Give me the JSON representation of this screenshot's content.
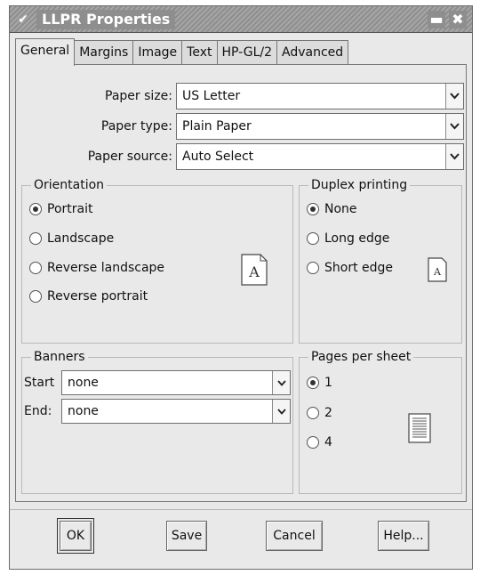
{
  "window": {
    "title": "LLPR Properties",
    "menu_glyph": "✔",
    "minimize_glyph": "▬",
    "close_glyph": "✖"
  },
  "tabs": [
    {
      "label": "General",
      "active": true
    },
    {
      "label": "Margins"
    },
    {
      "label": "Image"
    },
    {
      "label": "Text"
    },
    {
      "label": "HP-GL/2"
    },
    {
      "label": "Advanced"
    }
  ],
  "paper": {
    "size_label": "Paper size:",
    "size_value": "US Letter",
    "type_label": "Paper type:",
    "type_value": "Plain Paper",
    "source_label": "Paper source:",
    "source_value": "Auto Select"
  },
  "orientation": {
    "title": "Orientation",
    "options": [
      "Portrait",
      "Landscape",
      "Reverse landscape",
      "Reverse portrait"
    ],
    "selected": 0,
    "preview_letter": "A"
  },
  "duplex": {
    "title": "Duplex printing",
    "options": [
      "None",
      "Long edge",
      "Short edge"
    ],
    "selected": 0,
    "preview_letter": "A"
  },
  "banners": {
    "title": "Banners",
    "start_label": "Start",
    "start_value": "none",
    "end_label": "End:",
    "end_value": "none"
  },
  "pages_per_sheet": {
    "title": "Pages per sheet",
    "options": [
      "1",
      "2",
      "4"
    ],
    "selected": 0
  },
  "buttons": {
    "ok": "OK",
    "save": "Save",
    "cancel": "Cancel",
    "help": "Help..."
  }
}
